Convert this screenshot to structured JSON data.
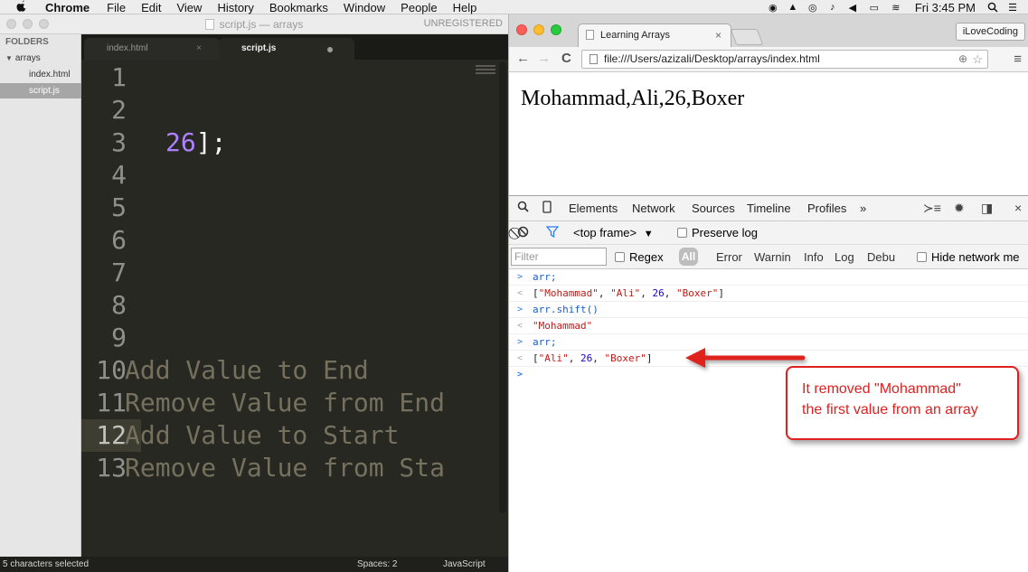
{
  "menubar": {
    "app_name": "Chrome",
    "items": [
      "File",
      "Edit",
      "View",
      "History",
      "Bookmarks",
      "Window",
      "People",
      "Help"
    ],
    "clock": "Fri 3:45 PM"
  },
  "sublime": {
    "window_title": "script.js — arrays",
    "unregistered": "UNREGISTERED",
    "sidebar": {
      "header": "FOLDERS",
      "folder": "arrays",
      "files": [
        "index.html",
        "script.js"
      ]
    },
    "tabs": [
      {
        "label": "index.html",
        "close": "×"
      },
      {
        "label": "script.js"
      }
    ],
    "lines": [
      {
        "num": "1",
        "code": ""
      },
      {
        "num": "2",
        "code": ""
      },
      {
        "num": "3",
        "code_num": "26",
        "code": "];"
      },
      {
        "num": "4",
        "code": ""
      },
      {
        "num": "5",
        "code": ""
      },
      {
        "num": "6",
        "code": ""
      },
      {
        "num": "7",
        "code": ""
      },
      {
        "num": "8",
        "code": ""
      },
      {
        "num": "9",
        "code": ""
      },
      {
        "num": "10",
        "code": "Add Value to End"
      },
      {
        "num": "11",
        "code": "Remove Value from End"
      },
      {
        "num": "12",
        "code": "Add Value to Start"
      },
      {
        "num": "13",
        "code": "Remove Value from Sta"
      }
    ],
    "status": {
      "selection": "5 characters selected",
      "spaces": "Spaces: 2",
      "language": "JavaScript"
    }
  },
  "chrome": {
    "tab_title": "Learning Arrays",
    "tab_close": "×",
    "profile": "iLoveCoding",
    "url": "file:///Users/azizali/Desktop/arrays/index.html",
    "page_output": "Mohammad,Ali,26,Boxer",
    "devtools": {
      "tabs": [
        "Elements",
        "Network",
        "Sources",
        "Timeline",
        "Profiles"
      ],
      "more": "»",
      "frame": "<top frame>",
      "preserve_log": "Preserve log",
      "filter_placeholder": "Filter",
      "regex": "Regex",
      "all": "All",
      "levels": [
        "Error",
        "Warnin",
        "Info",
        "Log",
        "Debu"
      ],
      "hide_network": "Hide network me"
    },
    "console": [
      {
        "kind": "in",
        "text": "arr;"
      },
      {
        "kind": "out",
        "parts": [
          [
            "p",
            "["
          ],
          [
            "s",
            "\"Mohammad\""
          ],
          [
            "p",
            ", "
          ],
          [
            "s",
            "\"Ali\""
          ],
          [
            "p",
            ", "
          ],
          [
            "n",
            "26"
          ],
          [
            "p",
            ", "
          ],
          [
            "s",
            "\"Boxer\""
          ],
          [
            "p",
            "]"
          ]
        ]
      },
      {
        "kind": "in",
        "text": "arr.shift()"
      },
      {
        "kind": "out",
        "parts": [
          [
            "s",
            "\"Mohammad\""
          ]
        ]
      },
      {
        "kind": "in",
        "text": "arr;"
      },
      {
        "kind": "out",
        "parts": [
          [
            "p",
            "["
          ],
          [
            "s",
            "\"Ali\""
          ],
          [
            "p",
            ", "
          ],
          [
            "n",
            "26"
          ],
          [
            "p",
            ", "
          ],
          [
            "s",
            "\"Boxer\""
          ],
          [
            "p",
            "]"
          ]
        ]
      }
    ]
  },
  "annotation": {
    "line1": "It removed \"Mohammad\"",
    "line2": "the first value from an array",
    "color": "#e0201e"
  }
}
